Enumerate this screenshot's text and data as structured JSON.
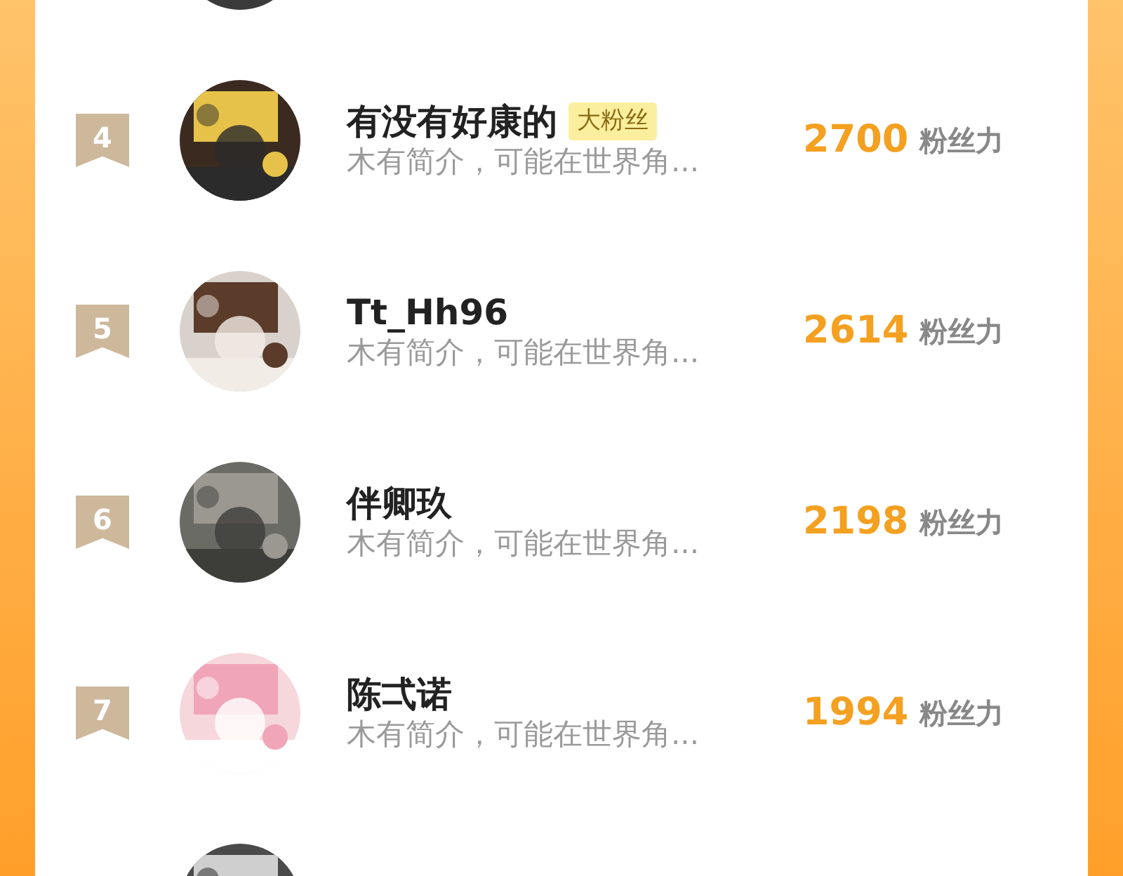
{
  "rows": [
    {
      "avatar": {
        "kind": "picture"
      }
    },
    {
      "rank": "4",
      "name": "有没有好康的",
      "tag": "大粉丝",
      "bio": "木有简介，可能在世界角...",
      "count": "2700",
      "unit": "粉丝力",
      "avatar": {
        "kind": "picture"
      }
    },
    {
      "rank": "5",
      "name": "Tt_Hh96",
      "bio": "木有简介，可能在世界角...",
      "count": "2614",
      "unit": "粉丝力",
      "avatar": {
        "kind": "picture"
      }
    },
    {
      "rank": "6",
      "name": "伴卿玖",
      "bio": "木有简介，可能在世界角...",
      "count": "2198",
      "unit": "粉丝力",
      "avatar": {
        "kind": "picture"
      }
    },
    {
      "rank": "7",
      "name": "陈弌诺",
      "bio": "木有简介，可能在世界角...",
      "count": "1994",
      "unit": "粉丝力",
      "avatar": {
        "kind": "picture"
      }
    },
    {
      "avatar": {
        "kind": "picture"
      }
    }
  ]
}
